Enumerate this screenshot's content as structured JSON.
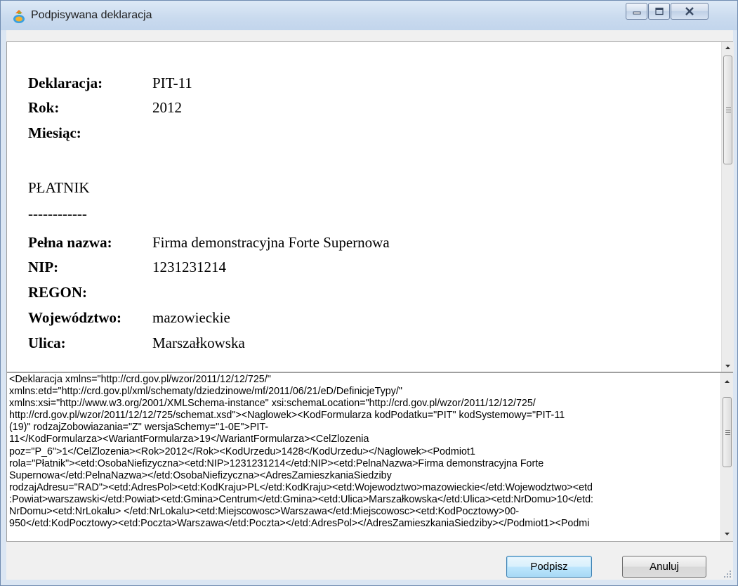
{
  "window": {
    "title": "Podpisywana deklaracja",
    "icon": "app-icon"
  },
  "preview": {
    "rows": [
      {
        "label": "Deklaracja:",
        "value": "PIT-11"
      },
      {
        "label": "Rok:",
        "value": "2012"
      },
      {
        "label": "Miesiąc:",
        "value": ""
      }
    ],
    "section_title": "PŁATNIK",
    "separator": "------------",
    "payer_rows": [
      {
        "label": "Pełna nazwa:",
        "value": "Firma demonstracyjna Forte Supernowa"
      },
      {
        "label": "NIP:",
        "value": "1231231214"
      },
      {
        "label": "REGON:",
        "value": ""
      },
      {
        "label": "Województwo:",
        "value": "mazowieckie"
      },
      {
        "label": "Ulica:",
        "value": "Marszałkowska"
      }
    ]
  },
  "xml": {
    "lines": [
      "<Deklaracja xmlns=\"http://crd.gov.pl/wzor/2011/12/12/725/\"",
      "xmlns:etd=\"http://crd.gov.pl/xml/schematy/dziedzinowe/mf/2011/06/21/eD/DefinicjeTypy/\"",
      "xmlns:xsi=\"http://www.w3.org/2001/XMLSchema-instance\" xsi:schemaLocation=\"http://crd.gov.pl/wzor/2011/12/12/725/",
      "http://crd.gov.pl/wzor/2011/12/12/725/schemat.xsd\"><Naglowek><KodFormularza kodPodatku=\"PIT\" kodSystemowy=\"PIT-11",
      "(19)\" rodzajZobowiazania=\"Z\" wersjaSchemy=\"1-0E\">PIT-",
      "11</KodFormularza><WariantFormularza>19</WariantFormularza><CelZlozenia",
      "poz=\"P_6\">1</CelZlozenia><Rok>2012</Rok><KodUrzedu>1428</KodUrzedu></Naglowek><Podmiot1",
      "rola=\"Płatnik\"><etd:OsobaNiefizyczna><etd:NIP>1231231214</etd:NIP><etd:PelnaNazwa>Firma demonstracyjna Forte",
      "Supernowa</etd:PelnaNazwa></etd:OsobaNiefizyczna><AdresZamieszkaniaSiedziby",
      "rodzajAdresu=\"RAD\"><etd:AdresPol><etd:KodKraju>PL</etd:KodKraju><etd:Wojewodztwo>mazowieckie</etd:Wojewodztwo><etd",
      ":Powiat>warszawski</etd:Powiat><etd:Gmina>Centrum</etd:Gmina><etd:Ulica>Marszałkowska</etd:Ulica><etd:NrDomu>10</etd:",
      "NrDomu><etd:NrLokalu> </etd:NrLokalu><etd:Miejscowosc>Warszawa</etd:Miejscowosc><etd:KodPocztowy>00-",
      "950</etd:KodPocztowy><etd:Poczta>Warszawa</etd:Poczta></etd:AdresPol></AdresZamieszkaniaSiedziby></Podmiot1><Podmi"
    ]
  },
  "buttons": {
    "sign": "Podpisz",
    "cancel": "Anuluj"
  }
}
